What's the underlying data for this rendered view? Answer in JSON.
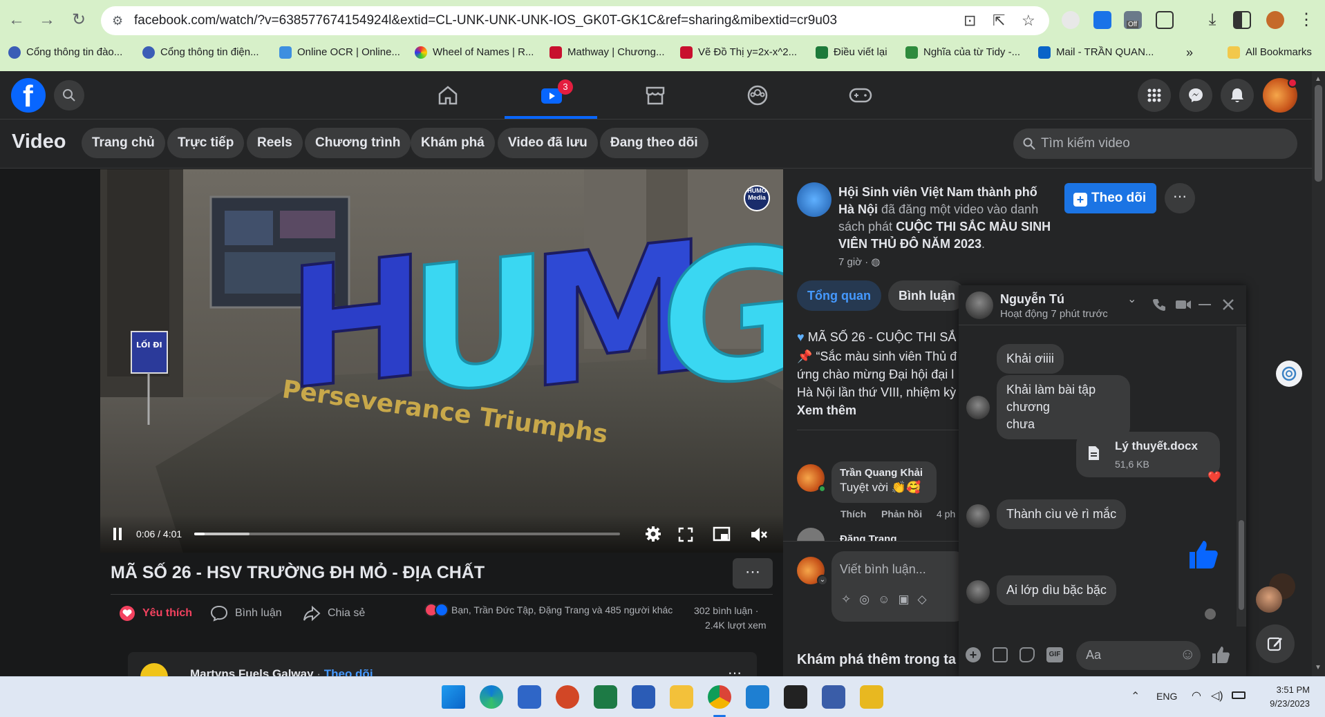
{
  "browser": {
    "url": "facebook.com/watch/?v=638577674154924l&extid=CL-UNK-UNK-UNK-IOS_GK0T-GK1C&ref=sharing&mibextid=cr9u03",
    "bookmarks": [
      "Cổng thông tin đào...",
      "Cổng thông tin điện...",
      "Online OCR | Online...",
      "Wheel of Names | R...",
      "Mathway | Chương...",
      "Vẽ Đồ Thị y=2x-x^2...",
      "Điều viết lại",
      "Nghĩa của từ Tidy -...",
      "Mail - TRẦN QUAN..."
    ],
    "more": "»",
    "all_bookmarks": "All Bookmarks",
    "ext_off": "Off"
  },
  "fb": {
    "video_badge": "3",
    "watch": {
      "title": "Video",
      "tabs": [
        "Trang chủ",
        "Trực tiếp",
        "Reels",
        "Chương trình",
        "Khám phá",
        "Video đã lưu",
        "Đang theo dõi"
      ],
      "search_placeholder": "Tìm kiếm video"
    },
    "player": {
      "time": "0:06 / 4:01",
      "progress": 0.025,
      "buffered": 0.13,
      "sign_text": "HUMG",
      "sign_motto": "Perseverance Triumphs",
      "badge_text": "HUMG Media",
      "signpost": "LỐI ĐI"
    },
    "video_title": "MÃ SỐ 26 - HSV TRƯỜNG ĐH MỎ - ĐỊA CHẤT",
    "actions": {
      "like": "Yêu thích",
      "comment": "Bình luận",
      "share": "Chia sẻ"
    },
    "stats": {
      "reactors": "Bạn, Trần Đức Tập, Đặng Trang và 485 người khác",
      "comments": "302 bình luận",
      "separator": "·",
      "views": "2.4K lượt xem"
    },
    "next_post": {
      "page": "Martyns Fuels Galway",
      "dot": "·",
      "follow": "Theo dõi"
    },
    "post": {
      "page_line1": "Hội Sinh viên Việt Nam thành phố",
      "page_line2": "Hà Nội",
      "posted_a": "đã đăng một video vào danh",
      "posted_b": "sách phát",
      "playlist_a": "CUỘC THI SẮC MÀU SINH",
      "playlist_b": "VIÊN THỦ ĐÔ NĂM 2023",
      "period": ".",
      "time": "7 giờ ·",
      "follow": "Theo dõi",
      "tabs": [
        "Tổng quan",
        "Bình luận"
      ],
      "desc": [
        "MÃ SỐ 26 - CUỘC THI SẮ",
        "“Sắc màu sinh viên Thủ đ",
        "ứng chào mừng Đại hội đại l",
        "Hà Nội lần thứ VIII, nhiệm kỳ"
      ],
      "see_more": "Xem thêm"
    },
    "comment": {
      "author": "Trần Quang Khải",
      "text": "Tuyệt vời",
      "emoji": "👏🥰",
      "like": "Thích",
      "reply": "Phản hồi",
      "time": "4 ph",
      "next_author": "Đặng Trang",
      "write_placeholder": "Viết bình luận..."
    },
    "explore": "Khám phá thêm trong ta"
  },
  "messenger": {
    "name": "Nguyễn Tú",
    "status": "Hoạt động 7 phút trước",
    "messages": [
      "Khải ơiiii",
      "Khải làm bài tập chương",
      "chưa",
      "Thành cìu vè rì mắc",
      "Ai lớp dìu bặc bặc"
    ],
    "file": {
      "name": "Lý thuyết.docx",
      "size": "51,6 KB"
    },
    "input_placeholder": "Aa",
    "reaction": "❤️",
    "thumb": "👍"
  },
  "taskbar": {
    "lang": "ENG",
    "time": "3:51 PM",
    "date": "9/23/2023"
  },
  "colors": {
    "fb_blue": "#0866ff",
    "follow_btn": "#1b74e4",
    "like_red": "#f3425f",
    "chrome_green": "#d7f0c9"
  }
}
